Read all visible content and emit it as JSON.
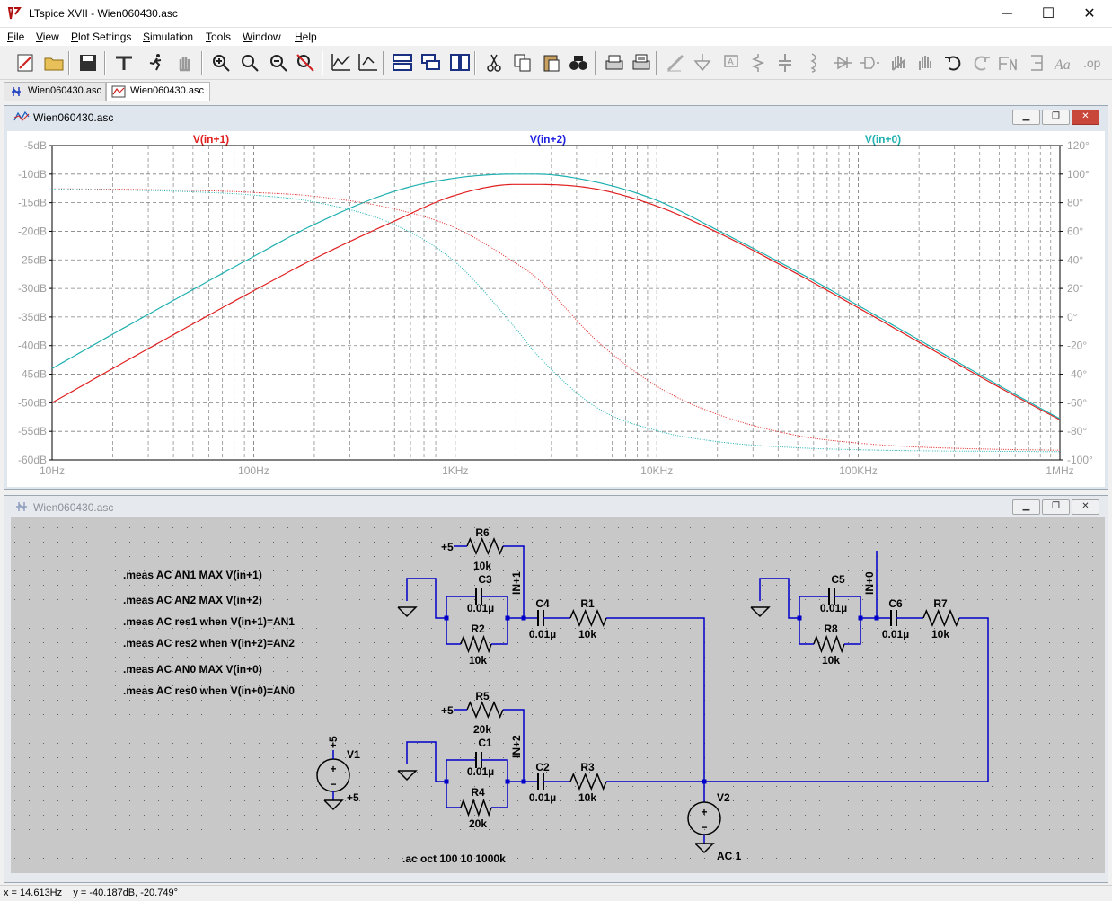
{
  "app": {
    "title": "LTspice XVII - Wien060430.asc",
    "window_controls": {
      "minimize": "─",
      "maximize": "☐",
      "close": "✕"
    }
  },
  "menu": [
    {
      "label": "File",
      "key": "F",
      "rest": "ile"
    },
    {
      "label": "View",
      "key": "V",
      "rest": "iew"
    },
    {
      "label": "Plot Settings",
      "key": "P",
      "rest": "lot Settings"
    },
    {
      "label": "Simulation",
      "key": "S",
      "rest": "imulation"
    },
    {
      "label": "Tools",
      "key": "T",
      "rest": "ools"
    },
    {
      "label": "Window",
      "key": "W",
      "rest": "indow"
    },
    {
      "label": "Help",
      "key": "H",
      "rest": "elp"
    }
  ],
  "toolbar_icons": [
    "new-schematic-icon",
    "open-icon",
    "save-icon",
    "control-panel-icon",
    "run-icon",
    "halt-icon",
    "zoom-in-icon",
    "zoom-full-icon",
    "zoom-out-icon",
    "zoom-cancel-icon",
    "autoscale-icon",
    "autoscale-y-icon",
    "tile-horizontal-icon",
    "cascade-icon",
    "tile-vertical-icon",
    "cut-icon",
    "copy-icon",
    "paste-icon",
    "find-icon",
    "print-icon",
    "print-setup-icon",
    "draw-wire-icon",
    "ground-icon",
    "label-net-icon",
    "resistor-icon",
    "capacitor-icon",
    "inductor-icon",
    "diode-icon",
    "component-icon",
    "move-icon",
    "drag-icon",
    "undo-icon",
    "redo-icon",
    "rotate-icon",
    "mirror-icon",
    "text-icon",
    "spice-directive-icon"
  ],
  "tabs": [
    {
      "label": "Wien060430.asc",
      "icon": "schematic-icon"
    },
    {
      "label": "Wien060430.asc",
      "icon": "waveform-icon"
    }
  ],
  "plot_window": {
    "title": "Wien060430.asc",
    "traces": [
      {
        "label": "V(in+1)",
        "color": "#e02020"
      },
      {
        "label": "V(in+2)",
        "color": "#2020e0"
      },
      {
        "label": "V(in+0)",
        "color": "#20b0b0"
      }
    ]
  },
  "chart_data": {
    "type": "line",
    "title": "",
    "x_scale": "log",
    "xlim": [
      10,
      1000000
    ],
    "x_tick_labels": [
      "10Hz",
      "100Hz",
      "1KHz",
      "10KHz",
      "100KHz",
      "1MHz"
    ],
    "y_left_lim": [
      -60,
      -5
    ],
    "y_left_tick_labels": [
      "-5dB",
      "-10dB",
      "-15dB",
      "-20dB",
      "-25dB",
      "-30dB",
      "-35dB",
      "-40dB",
      "-45dB",
      "-50dB",
      "-55dB",
      "-60dB"
    ],
    "y_right_lim": [
      -100,
      120
    ],
    "y_right_tick_labels": [
      "120°",
      "100°",
      "80°",
      "60°",
      "40°",
      "20°",
      "0°",
      "-20°",
      "-40°",
      "-60°",
      "-80°",
      "-100°"
    ],
    "grid": true,
    "legend_placement": "top",
    "series": [
      {
        "name": "V(in+1)",
        "color": "#e02020",
        "style": "solid",
        "x": [
          10,
          20,
          50,
          100,
          200,
          500,
          1000,
          2000,
          2500,
          5000,
          10000,
          20000,
          50000,
          100000,
          200000,
          500000,
          1000000
        ],
        "y": [
          -50.0,
          -44.0,
          -36.2,
          -30.4,
          -24.8,
          -18.2,
          -13.7,
          -11.8,
          -11.8,
          -12.6,
          -15.6,
          -20.2,
          -27.5,
          -33.4,
          -39.4,
          -47.3,
          -53.0
        ]
      },
      {
        "name": "V(in+1) phase",
        "color": "#e02020",
        "style": "dotted",
        "x": [
          10,
          20,
          50,
          100,
          200,
          500,
          1000,
          2000,
          2500,
          5000,
          10000,
          20000,
          50000,
          100000,
          200000,
          500000,
          1000000
        ],
        "y": [
          89.7,
          89.4,
          88.6,
          87.2,
          84.5,
          75.6,
          62.4,
          37.6,
          28.1,
          -16.1,
          -48.4,
          -68.1,
          -83.0,
          -88.2,
          -91.0,
          -92.6,
          -93.2
        ]
      },
      {
        "name": "V(in+0)",
        "color": "#20b0b0",
        "style": "solid",
        "x": [
          10,
          20,
          50,
          100,
          200,
          500,
          1000,
          2000,
          2500,
          5000,
          10000,
          20000,
          50000,
          100000,
          200000,
          500000,
          1000000
        ],
        "y": [
          -44.0,
          -38.0,
          -30.2,
          -24.4,
          -18.8,
          -13.0,
          -10.7,
          -10.0,
          -10.0,
          -11.4,
          -14.6,
          -19.8,
          -27.1,
          -33.0,
          -39.0,
          -47.0,
          -52.8
        ]
      },
      {
        "name": "V(in+0) phase",
        "color": "#20b0b0",
        "style": "dotted",
        "x": [
          10,
          20,
          50,
          100,
          200,
          500,
          1000,
          2000,
          2500,
          5000,
          10000,
          20000,
          50000,
          100000,
          200000,
          500000,
          1000000
        ],
        "y": [
          89.5,
          89.0,
          87.6,
          85.3,
          80.5,
          64.6,
          38.5,
          -8.2,
          -25.2,
          -63.1,
          -79.5,
          -87.2,
          -91.5,
          -92.9,
          -93.6,
          -94.0,
          -94.2
        ]
      }
    ]
  },
  "schematic_window": {
    "title": "Wien060430.asc",
    "directives": [
      ".meas AC AN1 MAX V(in+1)",
      ".meas AC AN2 MAX V(in+2)",
      ".meas AC res1 when V(in+1)=AN1",
      ".meas AC res2 when V(in+2)=AN2",
      ".meas AC AN0 MAX V(in+0)",
      ".meas AC res0 when V(in+0)=AN0"
    ],
    "analysis": ".ac oct 100 10 1000k",
    "components": {
      "R6": {
        "name": "R6",
        "value": "10k"
      },
      "R2": {
        "name": "R2",
        "value": "10k"
      },
      "R1": {
        "name": "R1",
        "value": "10k"
      },
      "R5": {
        "name": "R5",
        "value": "20k"
      },
      "R4": {
        "name": "R4",
        "value": "20k"
      },
      "R3": {
        "name": "R3",
        "value": "10k"
      },
      "R8": {
        "name": "R8",
        "value": "10k"
      },
      "R7": {
        "name": "R7",
        "value": "10k"
      },
      "C3": {
        "name": "C3",
        "value": "0.01µ"
      },
      "C4": {
        "name": "C4",
        "value": "0.01µ"
      },
      "C1": {
        "name": "C1",
        "value": "0.01µ"
      },
      "C2": {
        "name": "C2",
        "value": "0.01µ"
      },
      "C5": {
        "name": "C5",
        "value": "0.01µ"
      },
      "C6": {
        "name": "C6",
        "value": "0.01µ"
      },
      "V1": {
        "name": "V1",
        "value": "+5",
        "pos_label": "+5"
      },
      "V2": {
        "name": "V2",
        "value": "AC 1"
      }
    },
    "net_labels": {
      "in1": "IN+1",
      "in2": "IN+2",
      "in0": "IN+0",
      "plus5": "+5"
    }
  },
  "status": {
    "text": "x = 14.613Hz    y = -40.187dB, -20.749°"
  }
}
